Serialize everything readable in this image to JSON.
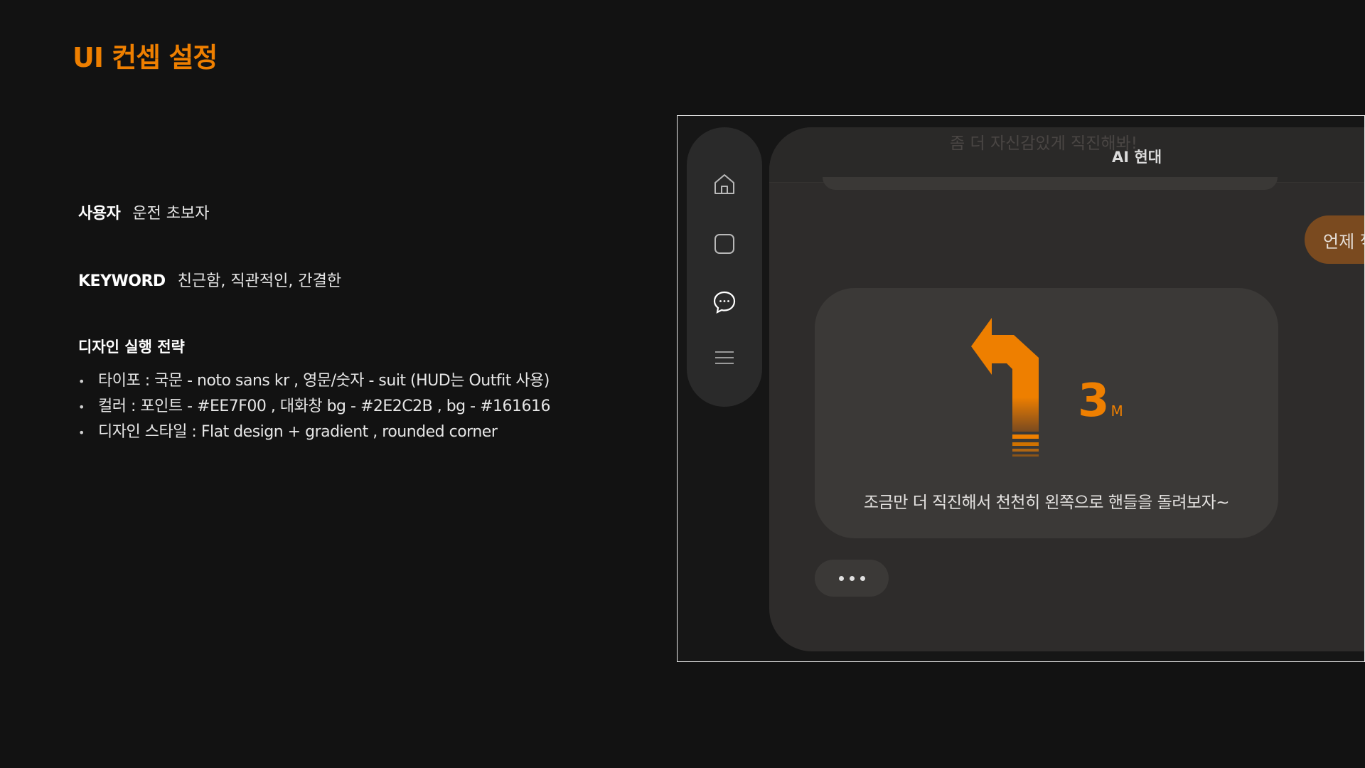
{
  "page_title": "UI 컨셉 설정",
  "user": {
    "label": "사용자",
    "value": "운전 초보자"
  },
  "keyword": {
    "label": "KEYWORD",
    "value": "친근함, 직관적인, 간결한"
  },
  "strategy": {
    "title": "디자인 실행 전략",
    "items": [
      "타이포 : 국문 - noto sans kr , 영문/숫자 - suit (HUD는 Outfit 사용)",
      "컬러 : 포인트 - #EE7F00 , 대화창 bg - #2E2C2B , bg - #161616",
      "디자인 스타일 : Flat design + gradient , rounded corner"
    ]
  },
  "mockup": {
    "header_title": "AI 현대",
    "faded_prev_message": "좀 더 자신감있게 직진해봐!",
    "user_bubble_text": "언제 꺾",
    "distance_value": "3",
    "distance_unit": "M",
    "ai_message": "조금만 더 직진해서 천천히 왼쪽으로 핸들을 돌려보자~",
    "rail_icons": [
      "home-icon",
      "square-icon",
      "chat-icon",
      "menu-icon"
    ],
    "active_rail_icon": "chat-icon"
  },
  "colors": {
    "accent": "#EE7F00",
    "chat_bg": "#2E2C2B",
    "bg": "#161616"
  }
}
